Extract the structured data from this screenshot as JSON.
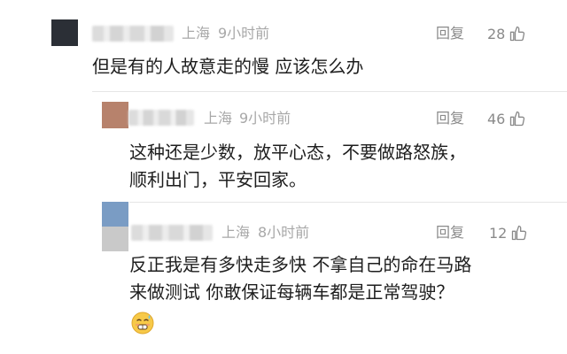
{
  "comments": [
    {
      "location": "上海",
      "time": "9小时前",
      "reply_label": "回复",
      "likes": "28",
      "text": "但是有的人故意走的慢 应该怎么办",
      "avatar_color": "#2b2f36"
    },
    {
      "location": "上海",
      "time": "9小时前",
      "reply_label": "回复",
      "likes": "46",
      "text": "这种还是少数，放平心态，不要做路怒族，\n顺利出门，平安回家。",
      "avatar_color": "#b7826c"
    },
    {
      "location": "上海",
      "time": "8小时前",
      "reply_label": "回复",
      "likes": "12",
      "text": "反正我是有多快走多快 不拿自己的命在马路\n来做测试 你敢保证每辆车都是正常驾驶？",
      "avatar_color_top": "#7a9cc4",
      "avatar_color_bottom": "#c9c9c9",
      "emoji": "grimacing-sweat-face"
    }
  ],
  "icons": {
    "like": "thumbs-up-icon"
  }
}
